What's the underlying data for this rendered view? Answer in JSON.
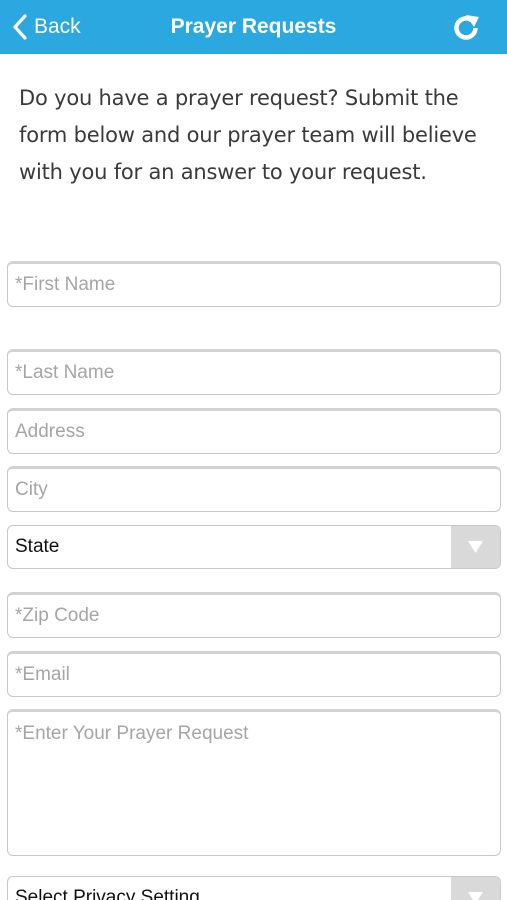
{
  "navbar": {
    "back_label": "Back",
    "title": "Prayer Requests",
    "back_icon": "chevron-left-icon",
    "refresh_icon": "refresh-icon",
    "background": "#2aa8df"
  },
  "intro": {
    "text": "Do you have a prayer request? Submit the form below and our prayer team will believe with you for an answer to your request."
  },
  "form": {
    "first_name_placeholder": "*First Name",
    "last_name_placeholder": "*Last Name",
    "address_placeholder": "Address",
    "city_placeholder": "City",
    "state_value": "State",
    "zip_placeholder": "*Zip Code",
    "email_placeholder": "*Email",
    "prayer_request_placeholder": "*Enter Your Prayer Request",
    "privacy_value": "Select Privacy Setting"
  }
}
